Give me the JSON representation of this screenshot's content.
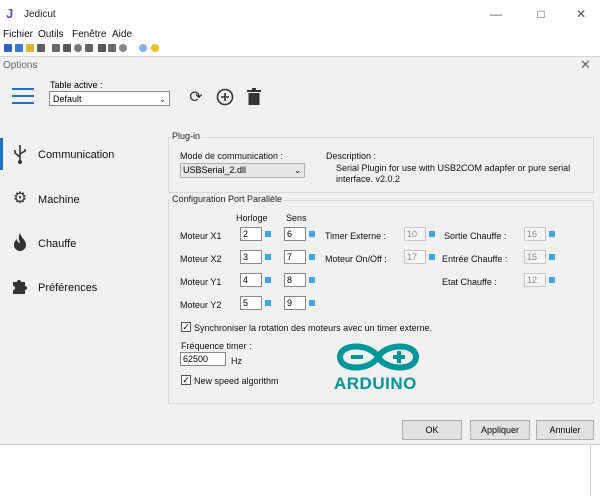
{
  "app": {
    "title": "Jedicut"
  },
  "menu": [
    "Fichier",
    "Outils",
    "Fenêtre",
    "Aide"
  ],
  "dialog": {
    "title": "Options",
    "table_label": "Table active :",
    "table_value": "Default"
  },
  "sidebar": {
    "items": [
      {
        "label": "Communication",
        "icon": "usb-icon",
        "active": true
      },
      {
        "label": "Machine",
        "icon": "gear-icon",
        "active": false
      },
      {
        "label": "Chauffe",
        "icon": "flame-icon",
        "active": false
      },
      {
        "label": "Préférences",
        "icon": "puzzle-icon",
        "active": false
      }
    ]
  },
  "plugin": {
    "title": "Plug-in",
    "mode_label": "Mode de communication :",
    "mode_value": "USBSerial_2.dll",
    "desc_label": "Description :",
    "desc_line1": "Serial Plugin for use with USB2COM adapfer or pure serial",
    "desc_line2": "interface. v2.0.2"
  },
  "port": {
    "title": "Configuration Port Parallèle",
    "horloge_header": "Horloge",
    "sens_header": "Sens",
    "motors": [
      {
        "label": "Moteur X1",
        "horloge": "2",
        "sens": "6"
      },
      {
        "label": "Moteur X2",
        "horloge": "3",
        "sens": "7"
      },
      {
        "label": "Moteur Y1",
        "horloge": "4",
        "sens": "8"
      },
      {
        "label": "Moteur Y2",
        "horloge": "5",
        "sens": "9"
      }
    ],
    "timer_externe_label": "Timer Externe :",
    "timer_externe_value": "10",
    "moteur_onoff_label": "Moteur On/Off :",
    "moteur_onoff_value": "17",
    "sortie_chauffe_label": "Sortie Chauffe :",
    "sortie_chauffe_value": "16",
    "entree_chauffe_label": "Entrée Chauffe :",
    "entree_chauffe_value": "15",
    "etat_chauffe_label": "Etat Chauffe :",
    "etat_chauffe_value": "12",
    "sync_label": "Synchroniser la rotation des moteurs avec un timer externe.",
    "sync_checked": true,
    "freq_label": "Fréquence timer :",
    "freq_value": "62500",
    "freq_unit": "Hz",
    "speed_label": "New speed algorithm",
    "speed_checked": true,
    "logo_text": "ARDUINO",
    "logo_color": "#00979c"
  },
  "buttons": {
    "ok": "OK",
    "apply": "Appliquer",
    "cancel": "Annuler"
  },
  "colors": {
    "accent": "#1f72c9",
    "spin": "#3ea6e6"
  }
}
